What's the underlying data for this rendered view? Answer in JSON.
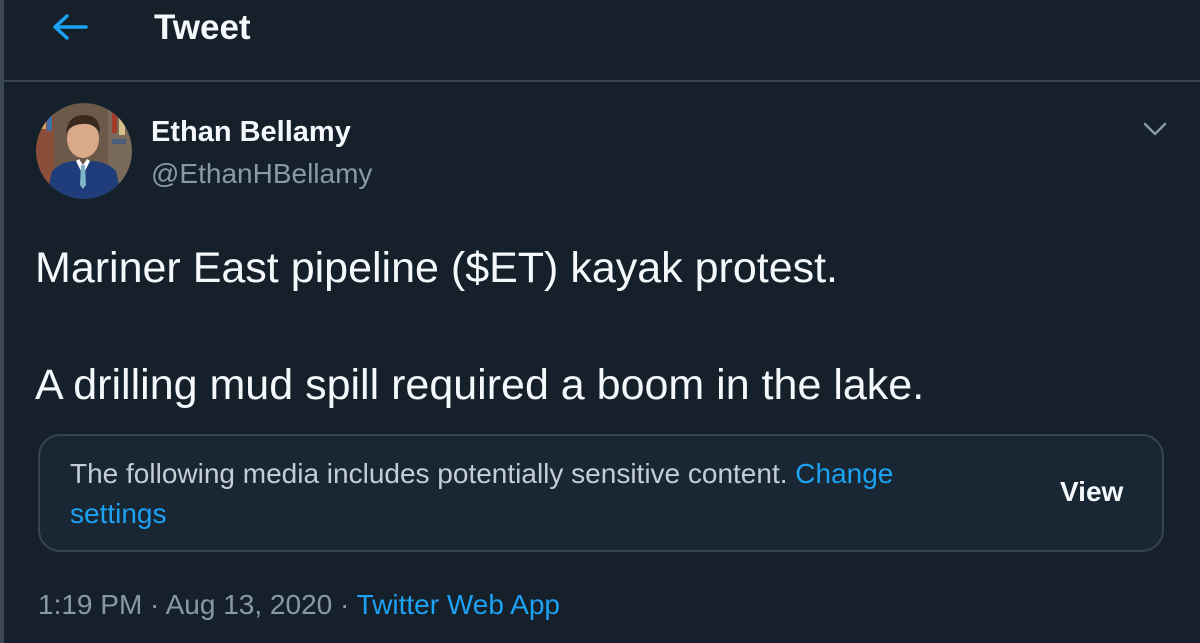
{
  "header": {
    "title": "Tweet",
    "back_icon": "arrow-left-icon",
    "accent": "#1da1f2"
  },
  "author": {
    "name": "Ethan Bellamy",
    "handle": "@EthanHBellamy"
  },
  "tweet": {
    "line1": "Mariner East pipeline ($ET) kayak protest.",
    "line2": "A drilling mud spill required a boom in the lake."
  },
  "media_warning": {
    "text": "The following media includes potentially sensitive content.",
    "link_label": "Change settings",
    "view_label": "View"
  },
  "meta": {
    "time": "1:19 PM",
    "separator": " · ",
    "date": "Aug 13, 2020",
    "source": "Twitter Web App"
  },
  "colors": {
    "background": "#15202b",
    "text": "#f5f8fa",
    "secondary": "#8899a6",
    "link": "#1da1f2"
  }
}
